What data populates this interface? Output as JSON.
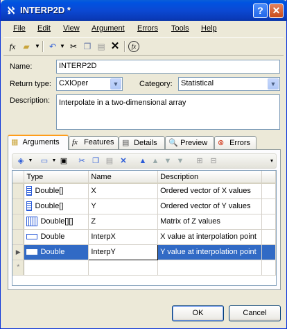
{
  "window": {
    "title": "INTERP2D *"
  },
  "menu": [
    "File",
    "Edit",
    "View",
    "Argument",
    "Errors",
    "Tools",
    "Help"
  ],
  "menu_mnemonic_index": [
    0,
    0,
    0,
    0,
    0,
    0,
    0
  ],
  "form": {
    "name_label": "Name:",
    "name_value": "INTERP2D",
    "return_type_label": "Return type:",
    "return_type_value": "CXlOper",
    "category_label": "Category:",
    "category_value": "Statistical",
    "description_label": "Description:",
    "description_value": "Interpolate in a two-dimensional array"
  },
  "tabs": [
    {
      "label": "Arguments",
      "icon": "arguments-icon",
      "active": true
    },
    {
      "label": "Features",
      "icon": "function-icon",
      "active": false
    },
    {
      "label": "Details",
      "icon": "details-icon",
      "active": false
    },
    {
      "label": "Preview",
      "icon": "preview-icon",
      "active": false
    },
    {
      "label": "Errors",
      "icon": "errors-icon",
      "active": false
    }
  ],
  "grid": {
    "columns": [
      "Type",
      "Name",
      "Description"
    ],
    "rows": [
      {
        "type_icon": "vector-icon",
        "type": "Double[]",
        "name": "X",
        "description": "Ordered vector of X values"
      },
      {
        "type_icon": "vector-icon",
        "type": "Double[]",
        "name": "Y",
        "description": "Ordered vector of Y values"
      },
      {
        "type_icon": "matrix-icon",
        "type": "Double[][]",
        "name": "Z",
        "description": "Matrix of Z values"
      },
      {
        "type_icon": "scalar-icon",
        "type": "Double",
        "name": "InterpX",
        "description": "X value at interpolation point"
      },
      {
        "type_icon": "scalar-icon",
        "type": "Double",
        "name": "InterpY",
        "description": "Y value at interpolation point",
        "selected": true
      }
    ]
  },
  "buttons": {
    "ok": "OK",
    "cancel": "Cancel"
  },
  "colors": {
    "title_bar": "#0a4bd4",
    "selection": "#316ac5",
    "active_tab_accent": "#ff9d1a"
  }
}
